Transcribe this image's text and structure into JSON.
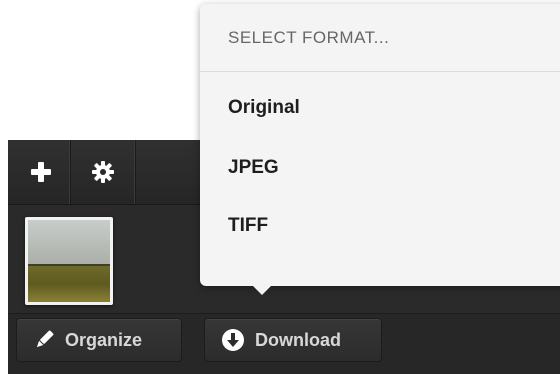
{
  "dropdown": {
    "header": "SELECT FORMAT...",
    "items": [
      {
        "label": "Original"
      },
      {
        "label": "JPEG"
      },
      {
        "label": "TIFF"
      }
    ]
  },
  "toolbar": {
    "add_icon": "plus-icon",
    "settings_icon": "gear-icon"
  },
  "bottom_bar": {
    "organize_label": "Organize",
    "organize_icon": "pencil-icon",
    "download_label": "Download",
    "download_icon": "download-circle-icon"
  },
  "colors": {
    "panel_bg": "#2b2b2b",
    "dropdown_bg": "#f4f4f4",
    "button_text": "#d8d8d8"
  }
}
